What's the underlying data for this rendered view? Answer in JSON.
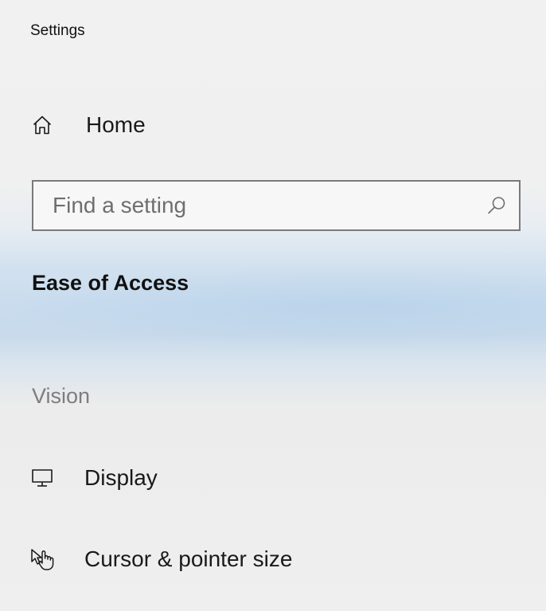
{
  "window": {
    "title": "Settings"
  },
  "nav": {
    "home": {
      "label": "Home",
      "icon": "home-icon"
    }
  },
  "search": {
    "placeholder": "Find a setting",
    "value": "",
    "icon": "search-icon"
  },
  "section": {
    "title": "Ease of Access"
  },
  "groups": [
    {
      "label": "Vision",
      "items": [
        {
          "label": "Display",
          "icon": "display-monitor-icon"
        },
        {
          "label": "Cursor & pointer size",
          "icon": "cursor-pointer-icon"
        }
      ]
    }
  ],
  "colors": {
    "highlight_band": "#c8daeb",
    "background": "#f0f0f0",
    "group_label": "#7d7d7d",
    "search_border": "#7a7a7a"
  }
}
